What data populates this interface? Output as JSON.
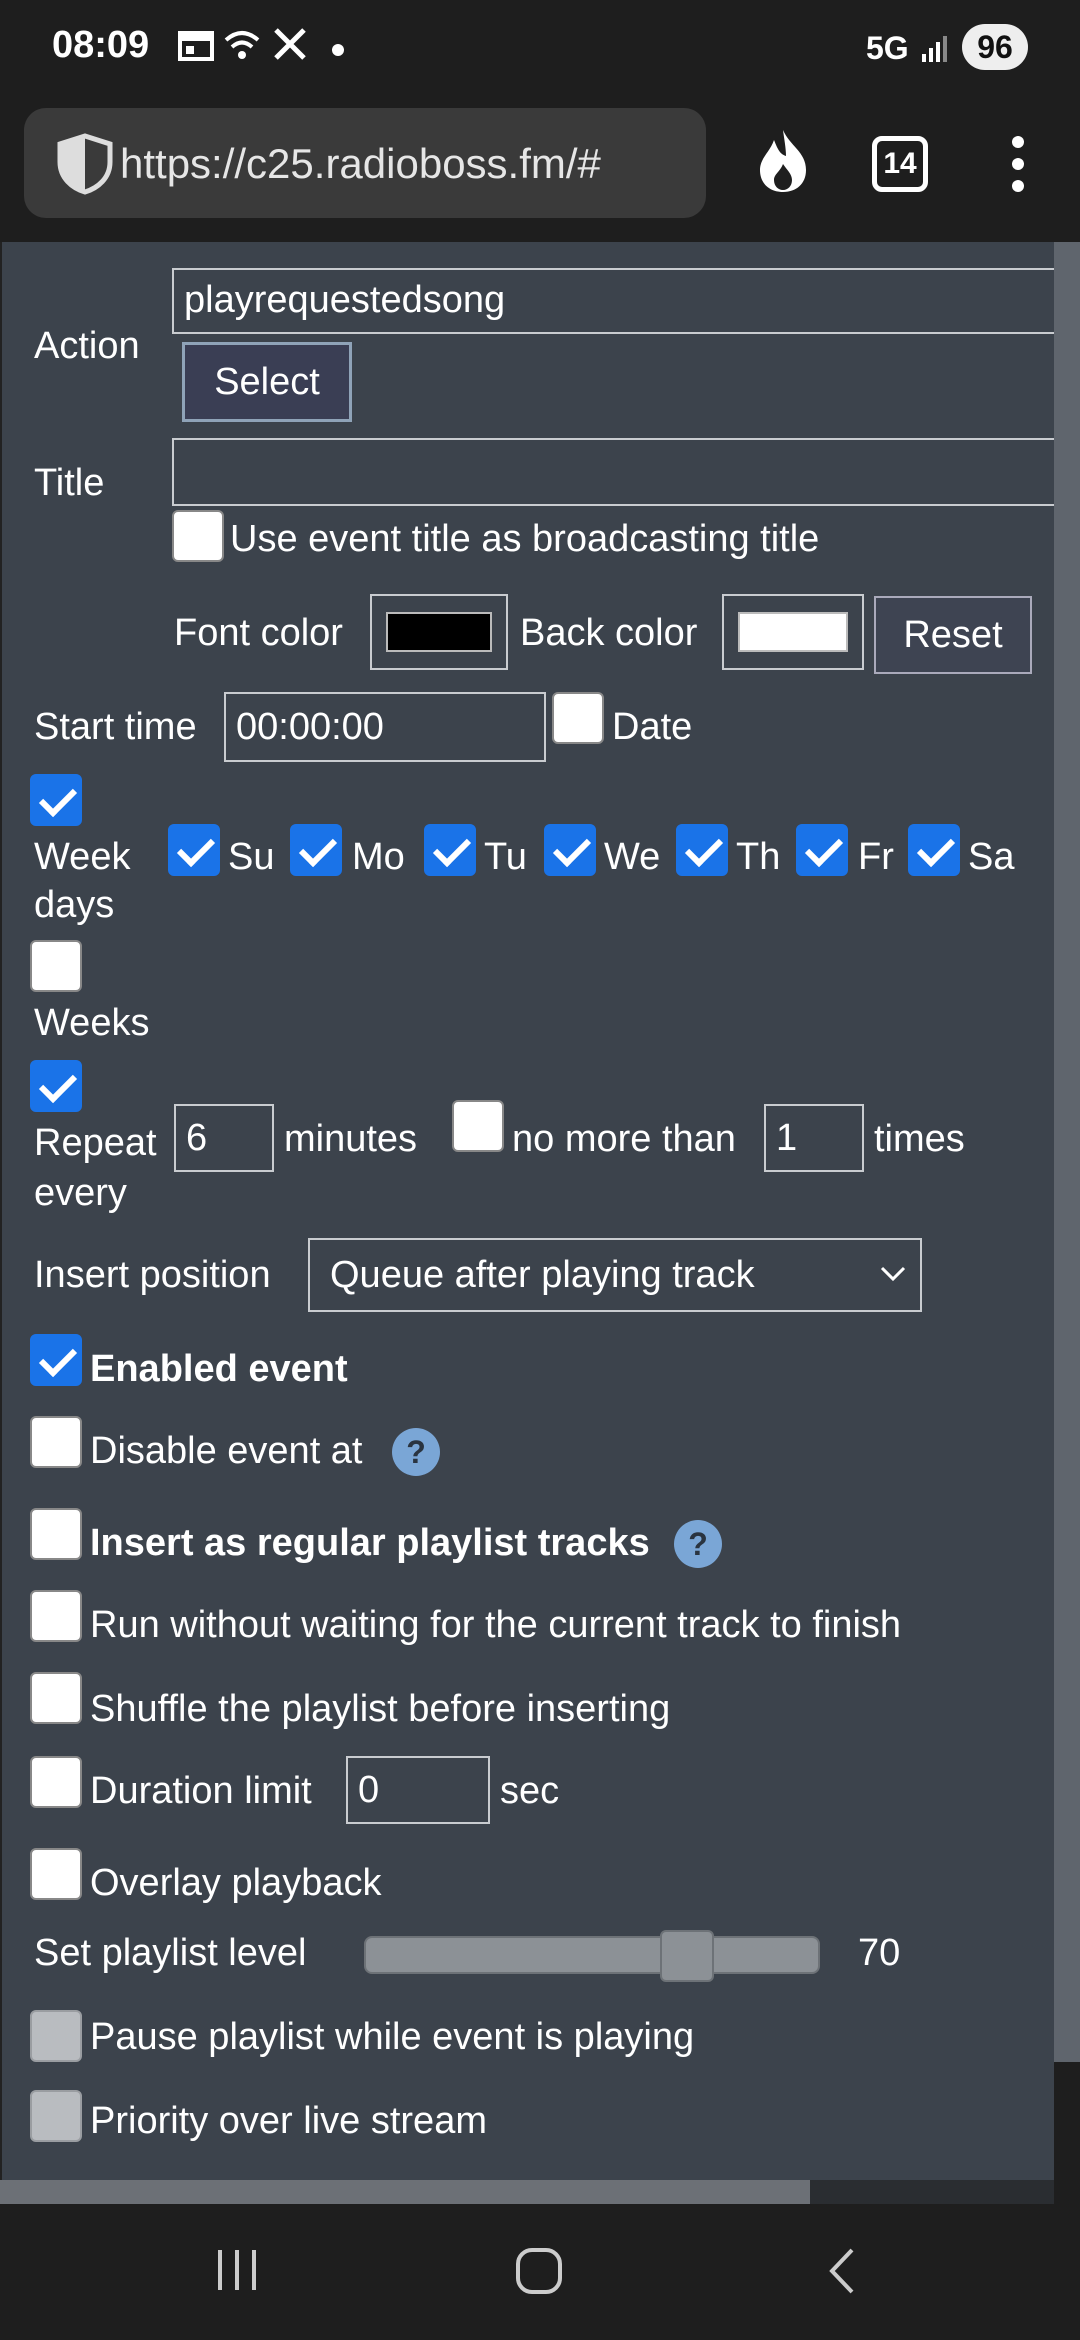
{
  "status": {
    "time": "08:09",
    "network": "5G",
    "battery": "96"
  },
  "browser": {
    "url": "https://c25.radioboss.fm/#",
    "tab_count": "14"
  },
  "form": {
    "action_label": "Action",
    "action_value": "playrequestedsong",
    "select_button": "Select",
    "title_label": "Title",
    "title_value": "",
    "use_title_label": "Use event title as broadcasting title",
    "font_color_label": "Font color",
    "back_color_label": "Back color",
    "reset_button": "Reset",
    "font_color": "#000000",
    "back_color": "#ffffff",
    "start_time_label": "Start time",
    "start_time_value": "00:00:00",
    "date_label": "Date",
    "week_days_label_1": "Week",
    "week_days_label_2": "days",
    "days": [
      "Su",
      "Mo",
      "Tu",
      "We",
      "Th",
      "Fr",
      "Sa"
    ],
    "weeks_label": "Weeks",
    "repeat_label_1": "Repeat",
    "repeat_label_2": "every",
    "repeat_value": "6",
    "minutes_label": "minutes",
    "no_more_than_label": "no more than",
    "times_value": "1",
    "times_label": "times",
    "insert_position_label": "Insert position",
    "insert_position_value": "Queue after playing track",
    "enabled_event_label": "Enabled event",
    "disable_event_label": "Disable event at",
    "insert_regular_label": "Insert as regular playlist tracks",
    "run_without_waiting_label": "Run without waiting for the current track to finish",
    "shuffle_label": "Shuffle the playlist before inserting",
    "duration_limit_label": "Duration limit",
    "duration_value": "0",
    "sec_label": "sec",
    "overlay_label": "Overlay playback",
    "playlist_level_label": "Set playlist level",
    "playlist_level_value": "70",
    "pause_playlist_label": "Pause playlist while event is playing",
    "priority_label": "Priority over live stream",
    "help_glyph": "?"
  },
  "colors": {
    "page_bg": "#3c434c",
    "checkbox_on": "#1a73e8",
    "help_bg": "#7aa6d6"
  }
}
